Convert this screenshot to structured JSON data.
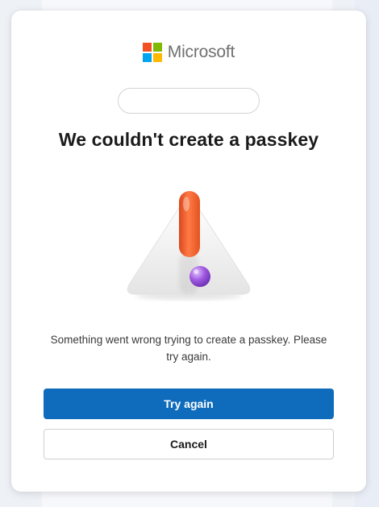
{
  "brand": {
    "name": "Microsoft",
    "logo_icon": "microsoft-logo-icon",
    "logo_colors": [
      "#f25022",
      "#7fba00",
      "#00a4ef",
      "#ffb900"
    ]
  },
  "account": {
    "value": ""
  },
  "dialog": {
    "title": "We couldn't create a passkey",
    "illustration_icon": "warning-triangle-icon",
    "message": "Something went wrong trying to create a passkey. Please try again."
  },
  "buttons": {
    "primary_label": "Try again",
    "secondary_label": "Cancel"
  },
  "colors": {
    "primary": "#0f6cbd",
    "exclamation": "#f0642f",
    "dot": "#a05ae0"
  }
}
